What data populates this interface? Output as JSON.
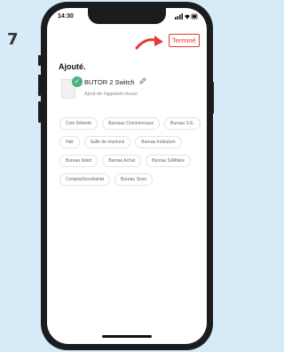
{
  "step_number": "7",
  "status_bar": {
    "time": "14:30"
  },
  "header": {
    "done_label": "Terminé"
  },
  "title": "Ajouté.",
  "device": {
    "name": "BUTOR 2 Switch",
    "subtitle": "Ajout de l'appareil réussi"
  },
  "rooms": [
    "Coin Détente",
    "Bureaux Commerciaux",
    "Bureau S.E.",
    "Hall",
    "Salle de réunions",
    "Bureau Indoutum",
    "Bureau Ilsled",
    "Bureau Achat",
    "Bureau S/Affaire",
    "Compta/Secrétariat",
    "Bureau Soen"
  ],
  "colors": {
    "accent": "#e53935",
    "success": "#43b581",
    "background": "#d6eaf8"
  }
}
